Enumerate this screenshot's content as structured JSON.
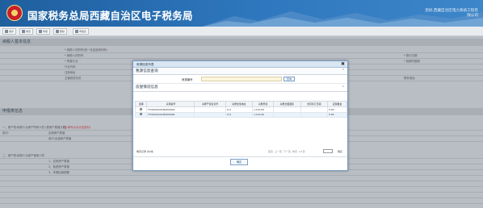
{
  "header": {
    "title": "国家税务总局西藏自治区电子税务局",
    "right_line1": "您好,西藏自治区电力系统工程有",
    "right_line2": "限公司"
  },
  "toolbar": {
    "buttons": [
      "保存",
      "重置",
      "申报",
      "删除",
      "申报表"
    ]
  },
  "background": {
    "section1": "纳税人基本信息",
    "section2": "申报表信息",
    "rows": [
      {
        "lbl": "* 纳税人识别号(统一社会信用代码)",
        "val": "",
        "r1": "",
        "rv": ""
      },
      {
        "lbl": "* 纳税人识别号",
        "val": "",
        "r1": "* 登记日期",
        "rv": ""
      },
      {
        "lbl": "* 所属行业",
        "val": "",
        "r1": "* 税款所属期",
        "rv": ""
      },
      {
        "lbl": "行业代码",
        "val": "",
        "r1": "",
        "rv": ""
      },
      {
        "lbl": "注册地址",
        "val": "",
        "r1": "",
        "rv": ""
      },
      {
        "lbl": "主管税务机关",
        "val": "",
        "r1": "联系电话",
        "rv": ""
      }
    ],
    "form_rows": [
      {
        "lbl": "一、房产税:纳税人为房产所有人的 (按房产原值计税)",
        "red": "(注:填写从价计征部分)",
        "r": ""
      },
      {
        "lbl": "其中:",
        "val": "应税房产原值",
        "r": ""
      },
      {
        "lbl": "",
        "val": "其中:出租房产原值",
        "r": ""
      },
      {
        "lbl": "二、房产税:纳税人为房产使用人的",
        "val": "",
        "r": ""
      },
      {
        "lbl": "",
        "val": "1、应税房产原值",
        "r": ""
      },
      {
        "lbl": "",
        "val": "2、免税房产原值",
        "r": ""
      },
      {
        "lbl": "",
        "val": "3、本期应纳税额",
        "r": ""
      },
      {
        "lbl": "",
        "val": "",
        "r": ""
      }
    ]
  },
  "modal": {
    "title": "房源信息列表",
    "query_section": "税源信息查询",
    "query_label": "房源编号",
    "query_value": "",
    "query_button": "查询",
    "list_section": "房屋情况信息",
    "columns": [
      "选择",
      "房源编号",
      "房屋产权证书号",
      "房屋坐落地址",
      "房屋原值",
      "房屋出租面积",
      "合同签订日期",
      "应税租金"
    ],
    "rows": [
      {
        "code": "F54010020180000004",
        "cert": "",
        "addr": "111",
        "orig": "1,110.00",
        "area": "",
        "date": "",
        "rent": "0.00"
      },
      {
        "code": "F54010020180000006",
        "cert": "",
        "addr": "111",
        "orig": "1,110.00",
        "area": "",
        "date": "",
        "rent": "0.00"
      }
    ],
    "pager": {
      "info": "每页记录 共2条",
      "nav": "首页 上一页 下一页 末页",
      "page": "1/1页",
      "go": "确定"
    },
    "confirm": "确定"
  }
}
